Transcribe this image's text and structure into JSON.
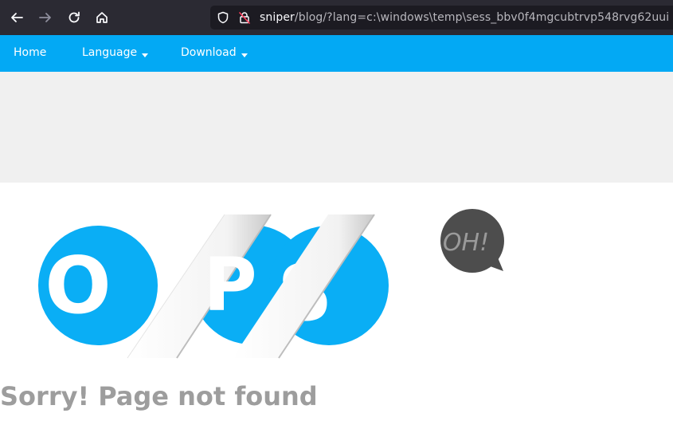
{
  "browser": {
    "url_host": "sniper",
    "url_rest": "/blog/?lang=c:\\windows\\temp\\sess_bbv0f4mgcubtrvp548rvg62uui"
  },
  "site_nav": {
    "items": [
      {
        "label": "Home"
      },
      {
        "label": "Language"
      },
      {
        "label": "Download"
      }
    ]
  },
  "error_page": {
    "letters": [
      "O",
      "P",
      "S"
    ],
    "bubble": "OH!",
    "title": "Sorry! Page not found"
  },
  "colors": {
    "accent": "#03a9f4",
    "circle": "#0aaef5",
    "bubble": "#4d4d4d",
    "title": "#9d9d9d"
  }
}
